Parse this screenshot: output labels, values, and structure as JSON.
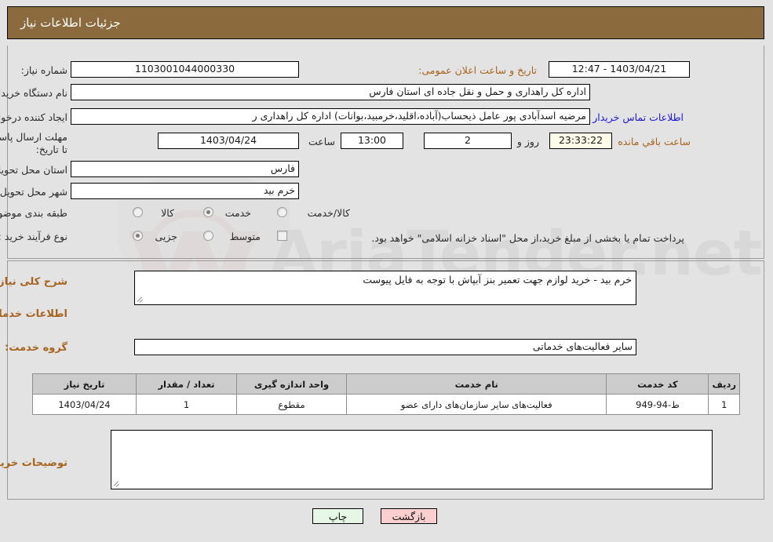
{
  "header": {
    "title": "جزئیات اطلاعات نیاز"
  },
  "colors": {
    "header_bg": "#8b6b3d",
    "label_orange": "#a6641e",
    "link_blue": "#1d15e0",
    "table_header": "#cccccc",
    "print_button": "#e6f7e6",
    "back_button": "#fbcfcf",
    "countdown_bg": "#fbfbe8"
  },
  "form": {
    "need_number_label": "شماره نیاز:",
    "need_number_value": "1103001044000330",
    "public_announce_label": "تاریخ و ساعت اعلان عمومی:",
    "public_announce_value": "1403/04/21 - 12:47",
    "buyer_org_label": "نام دستگاه خریدار:",
    "buyer_org_value": "اداره کل راهداری و حمل و نقل جاده ای استان فارس",
    "requester_label": "ایجاد کننده درخواست:",
    "requester_value": "مرضیه اسدآبادی پور عامل ذیحساب(آباده،اقلید،خرمبید،بوانات) اداره کل راهداری ر",
    "contact_link": "اطلاعات تماس خریدار",
    "deadline_label": "مهلت ارسال پاسخ: تا تاریخ:",
    "deadline_date": "1403/04/24",
    "hour_label": "ساعت",
    "deadline_time": "13:00",
    "days_remaining": "2",
    "days_label": "روز و",
    "countdown": "23:33:22",
    "remaining_label": "ساعت باقي مانده",
    "province_label": "استان محل تحویل:",
    "province_value": "فارس",
    "city_label": "شهر محل تحویل:",
    "city_value": "خرم بید",
    "category_label": "طبقه بندی موضوعی:",
    "category_options": [
      {
        "label": "کالا",
        "selected": false
      },
      {
        "label": "خدمت",
        "selected": true
      },
      {
        "label": "کالا/خدمت",
        "selected": false
      }
    ],
    "process_label": "نوع فرآیند خرید :",
    "process_options": [
      {
        "label": "جزیی",
        "selected": true
      },
      {
        "label": "متوسط",
        "selected": false
      }
    ],
    "treasury_checkbox_label": "پرداخت تمام یا بخشی از مبلغ خرید،از محل \"اسناد خزانه اسلامی\" خواهد بود.",
    "treasury_checked": false
  },
  "details": {
    "summary_label": "شرح کلی نیاز:",
    "summary_value": "خرم بید - خرید لوازم جهت تعمیر بنز آبپاش با توجه به فایل پیوست",
    "services_section_title": "اطلاعات خدمات مورد نیاز",
    "service_group_label": "گروه خدمت:",
    "service_group_value": "سایر فعالیت‌های خدماتی",
    "buyer_notes_label": "توضیحات خریدار:",
    "buyer_notes_value": ""
  },
  "table": {
    "columns": [
      "ردیف",
      "کد خدمت",
      "نام خدمت",
      "واحد اندازه گیری",
      "تعداد / مقدار",
      "تاریخ نیاز"
    ],
    "rows": [
      {
        "row": "1",
        "code": "ط-94-949",
        "name": "فعالیت‌های سایر سازمان‌های دارای عضو",
        "unit": "مقطوع",
        "qty": "1",
        "date": "1403/04/24"
      }
    ]
  },
  "footer": {
    "print_label": "چاپ",
    "back_label": "بازگشت"
  },
  "watermark": {
    "text": "AriaTender.net"
  }
}
